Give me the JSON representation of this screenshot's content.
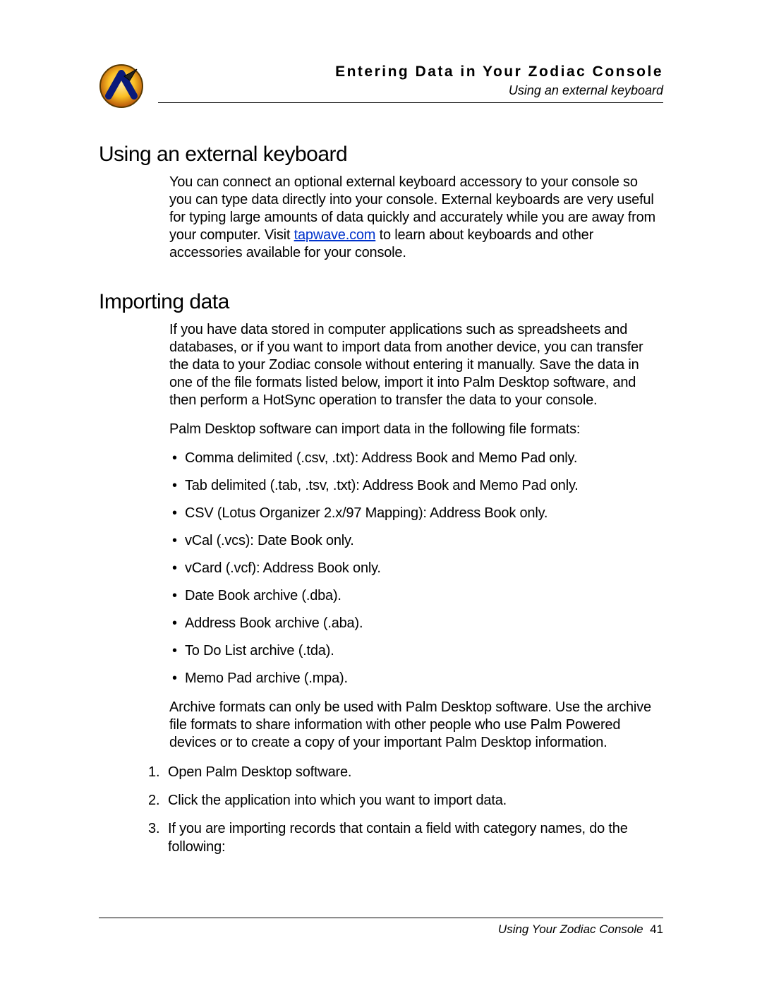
{
  "header": {
    "chapter_title": "Entering Data in Your Zodiac Console",
    "section_subtitle": "Using an external keyboard"
  },
  "section1": {
    "heading": "Using an external keyboard",
    "para_pre_link": "You can connect an optional external keyboard accessory to your console so you can type data directly into your console. External keyboards are very useful for typing large amounts of data quickly and accurately while you are away from your computer. Visit ",
    "link_text": "tapwave.com",
    "para_post_link": " to learn about keyboards and other accessories available for your console."
  },
  "section2": {
    "heading": "Importing data",
    "para1": "If you have data stored in computer applications such as spreadsheets and databases, or if you want to import data from another device, you can transfer the data to your Zodiac console without entering it manually. Save the data in one of the file formats listed below, import it into Palm Desktop software, and then perform a HotSync operation to transfer the data to your console.",
    "para2": "Palm Desktop software can import data in the following file formats:",
    "bullets": [
      "Comma delimited (.csv, .txt): Address Book and Memo Pad only.",
      "Tab delimited (.tab, .tsv, .txt): Address Book and Memo Pad only.",
      "CSV (Lotus Organizer 2.x/97 Mapping): Address Book only.",
      "vCal (.vcs): Date Book only.",
      "vCard (.vcf): Address Book only.",
      "Date Book archive (.dba).",
      "Address Book archive (.aba).",
      "To Do List archive (.tda).",
      "Memo Pad archive (.mpa)."
    ],
    "para3": "Archive formats can only be used with Palm Desktop software. Use the archive file formats to share information with other people who use Palm Powered devices or to create a copy of your important Palm Desktop information.",
    "steps": [
      "Open Palm Desktop software.",
      "Click the application into which you want to import data.",
      "If you are importing records that contain a field with category names, do the following:"
    ]
  },
  "footer": {
    "doc_title": "Using Your Zodiac Console",
    "page_number": "41"
  }
}
